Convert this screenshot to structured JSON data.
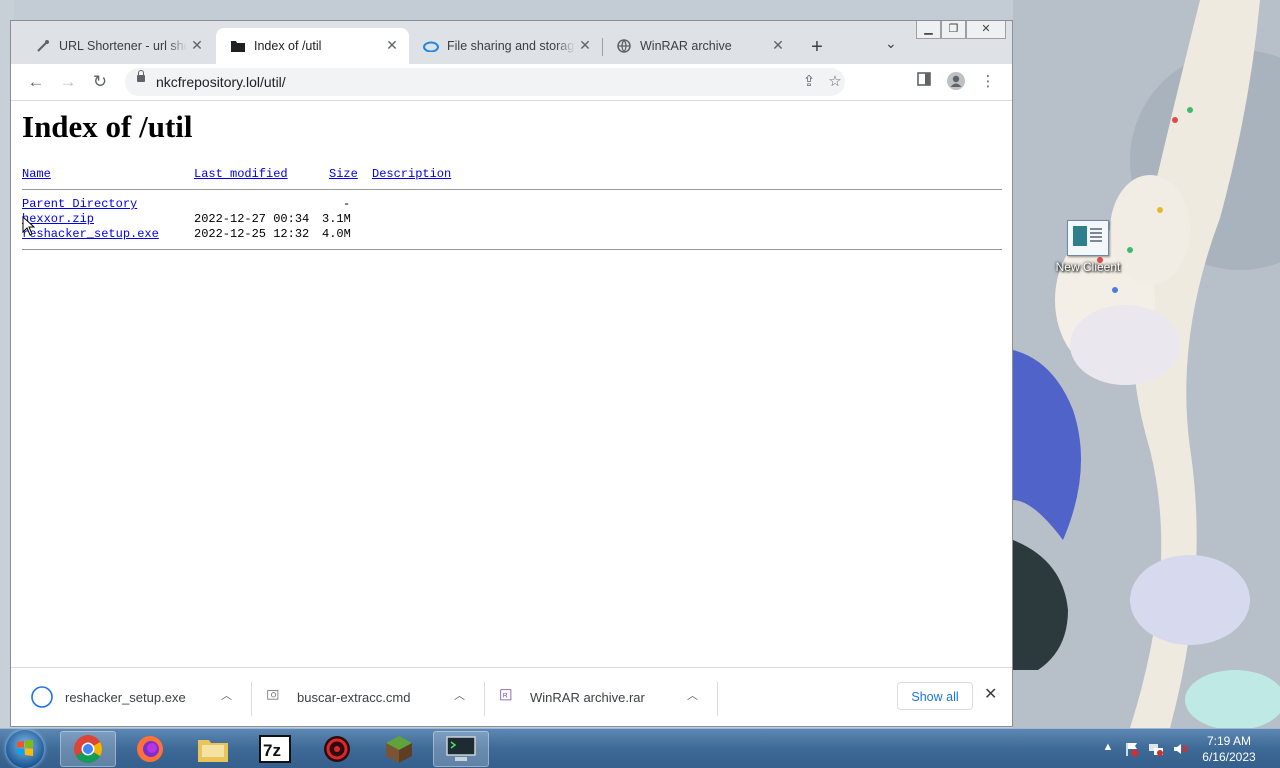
{
  "desktop": {
    "icons": [
      {
        "label": "New Clieent",
        "icon": "document-icon"
      }
    ]
  },
  "browser": {
    "tabs": [
      {
        "title": "URL Shortener - url shortener",
        "icon": "link-icon",
        "active": false
      },
      {
        "title": "Index of /util",
        "icon": "folder-icon",
        "active": true
      },
      {
        "title": "File sharing and storage made simple",
        "icon": "cloud-icon",
        "active": false
      },
      {
        "title": "WinRAR archive",
        "icon": "globe-icon",
        "active": false
      }
    ],
    "new_tab": "+",
    "url": "nkcfrepository.lol/util/"
  },
  "page": {
    "title": "Index of /util",
    "headers": {
      "name": "Name",
      "modified": "Last modified",
      "size": "Size",
      "description": "Description"
    },
    "parent": {
      "name": "Parent Directory",
      "size": "-"
    },
    "files": [
      {
        "name": "hexxor.zip",
        "modified": "2022-12-27 00:34",
        "size": "3.1M"
      },
      {
        "name": "reshacker_setup.exe",
        "modified": "2022-12-25 12:32",
        "size": "4.0M"
      }
    ]
  },
  "downloads": {
    "items": [
      {
        "name": "reshacker_setup.exe",
        "icon": "loading-ring-icon"
      },
      {
        "name": "buscar-extracc.cmd",
        "icon": "script-file-icon"
      },
      {
        "name": "WinRAR archive.rar",
        "icon": "winrar-icon"
      }
    ],
    "show_all": "Show all"
  },
  "taskbar": {
    "apps": [
      "chrome-icon",
      "firefox-icon",
      "explorer-icon",
      "7zip-icon",
      "app-icon",
      "minecraft-icon",
      "terminal-icon"
    ],
    "time": "7:19 AM",
    "date": "6/16/2023"
  },
  "colors": {
    "link": "#0000ee",
    "visited": "#551a8b",
    "accent": "#1a73e8"
  }
}
